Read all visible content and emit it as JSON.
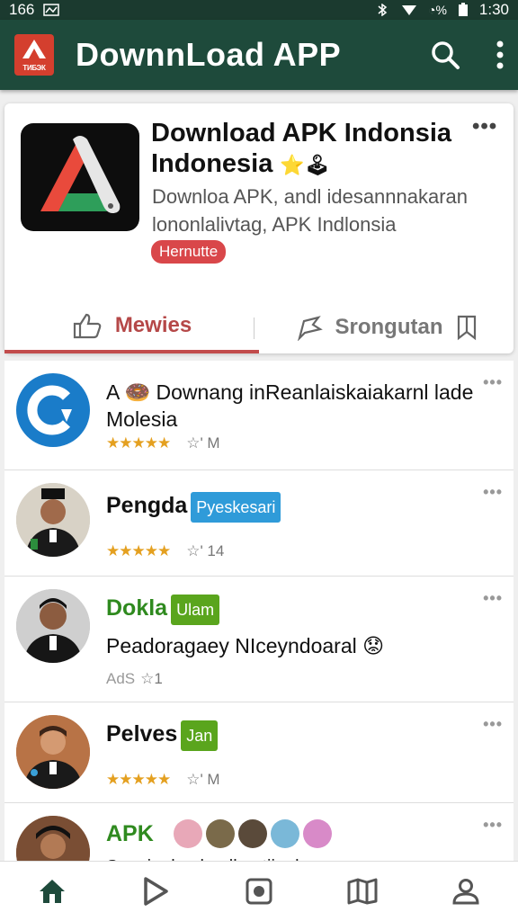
{
  "status_bar": {
    "left_text": "166",
    "time": "1:30",
    "battery_text": "%"
  },
  "app_bar": {
    "logo_text": "TИБЭК",
    "title": "DownnLoad APP",
    "accent": "#1e4a3b"
  },
  "app_card": {
    "title_line1": "Download APK Indonsia",
    "title_line2": "Indonesia",
    "title_emoji": "⭐🕹",
    "more": "•••",
    "description": "Downloa APK, andl idesannnakaran lononlalivtag, APK Indlonsia",
    "badge": "Hernutte",
    "badge_color": "#d9474a",
    "tabs": [
      {
        "label": "Mewies",
        "active": true
      },
      {
        "label": "Srongutan",
        "active": false
      }
    ]
  },
  "feed": [
    {
      "title": "A 🍩 Downang inReanlaiskaiakarnl lade Molesia",
      "stars": "★★★★★",
      "meta": "☆' M",
      "more": "•••"
    },
    {
      "name": "Pengda",
      "badge": "Pyeskesari",
      "badge_color": "#2f9bd9",
      "stars": "★★★★★",
      "meta": "☆' 14",
      "more": "•••"
    },
    {
      "name": "Dokla",
      "badge": "Ulam",
      "badge_color": "#5aa51d",
      "name_color": "#2f8a1f",
      "text": "Peadoragaey NIceyndoaral 😟",
      "ads": "AdS",
      "ads_meta": "☆1",
      "more": "•••"
    },
    {
      "name": "Pelves",
      "badge": "Jan",
      "badge_color": "#5aa51d",
      "stars": "★★★★★",
      "meta": "☆' M",
      "more": "•••"
    },
    {
      "name": "APK",
      "name_color": "#2f8a1f",
      "text": "Sunsinaknakaelkuutiinal",
      "more": "•••"
    }
  ],
  "bottom_nav": [
    "home-icon",
    "play-icon",
    "camera-icon",
    "map-icon",
    "profile-icon"
  ]
}
